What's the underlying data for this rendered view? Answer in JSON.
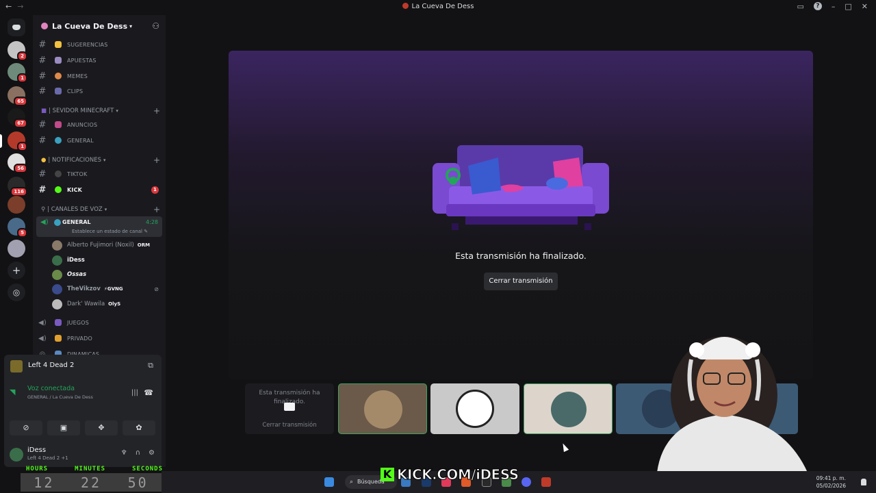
{
  "window": {
    "title": "La Cueva De Dess"
  },
  "server": {
    "name": "La Cueva De Dess"
  },
  "rail": {
    "badges": [
      "2",
      "1",
      "65",
      "67",
      "1",
      "56",
      "116",
      "5"
    ]
  },
  "channels": {
    "top": [
      {
        "label": "SUGERENCIAS"
      },
      {
        "label": "APUESTAS"
      },
      {
        "label": "MEMES"
      },
      {
        "label": "CLIPS"
      }
    ],
    "categories": {
      "minecraft": "| SEVIDOR MINECRAFT",
      "notificaciones": "| NOTIFICACIONES",
      "voz": "| CANALES DE VOZ"
    },
    "minecraft": [
      {
        "label": "ANUNCIOS"
      },
      {
        "label": "GENERAL"
      }
    ],
    "notificaciones": [
      {
        "label": "TIKTOK"
      },
      {
        "label": "KICK",
        "unread": "1"
      }
    ],
    "voice_general": {
      "label": "GENERAL",
      "time": "4:28",
      "status": "Establece un estado de canal ✎"
    },
    "voice_users": [
      {
        "name": "Alberto Fujimori (Noxil)",
        "tag": "ORM"
      },
      {
        "name": "iDess",
        "tag": ""
      },
      {
        "name": "Ossas",
        "tag": ""
      },
      {
        "name": "TheVikzov",
        "tag": "⚡GVNG"
      },
      {
        "name": "Dark' Wawila",
        "tag": "OlyS"
      }
    ],
    "voice_other": [
      {
        "label": "JUEGOS"
      },
      {
        "label": "PRIVADO"
      },
      {
        "label": "DINAMICAS"
      }
    ]
  },
  "activity": {
    "game": "Left 4 Dead 2"
  },
  "voice_panel": {
    "title": "Voz conectada",
    "subtitle": "GENERAL / La Cueva De Dess"
  },
  "user_panel": {
    "name": "iDess",
    "status": "Left 4 Dead 2 +1"
  },
  "stream": {
    "ended_text": "Esta transmisión ha finalizado.",
    "close_label": "Cerrar transmisión"
  },
  "tiles": {
    "ended_msg": "Esta transmisión ha finalizado.",
    "close_label": "Cerrar transmisión"
  },
  "overlay": {
    "timer_labels": [
      "HOURS",
      "MINUTES",
      "SECONDS"
    ],
    "timer_values": [
      "12",
      "22",
      "50"
    ],
    "brand": "KICK.COM/iDESS"
  },
  "taskbar": {
    "search_placeholder": "Búsqueda",
    "time": "09:41 p. m.",
    "date": "05/02/2026"
  },
  "colors": {
    "accent_green": "#23a55a",
    "badge_red": "#da373c",
    "kick_green": "#53fc18"
  }
}
